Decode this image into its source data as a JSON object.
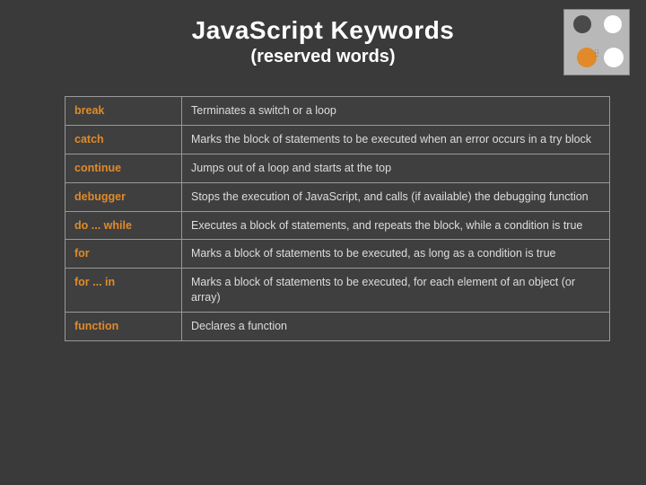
{
  "header": {
    "title": "JavaScript Keywords",
    "subtitle": "(reserved words)"
  },
  "rows": [
    {
      "keyword": "break",
      "description": "Terminates a switch or a loop"
    },
    {
      "keyword": "catch",
      "description": "Marks the block of statements to be executed when an error occurs in a try block"
    },
    {
      "keyword": "continue",
      "description": "Jumps out of a loop and starts at the top"
    },
    {
      "keyword": "debugger",
      "description": "Stops the execution of JavaScript, and calls (if available) the debugging function"
    },
    {
      "keyword": "do ... while",
      "description": "Executes a block of statements, and repeats the block, while a condition is true"
    },
    {
      "keyword": "for",
      "description": "Marks a block of statements to be executed, as long as a condition is true"
    },
    {
      "keyword": "for ... in",
      "description": "Marks a block of statements to be executed, for each element of an object (or array)"
    },
    {
      "keyword": "function",
      "description": "Declares a function"
    }
  ]
}
